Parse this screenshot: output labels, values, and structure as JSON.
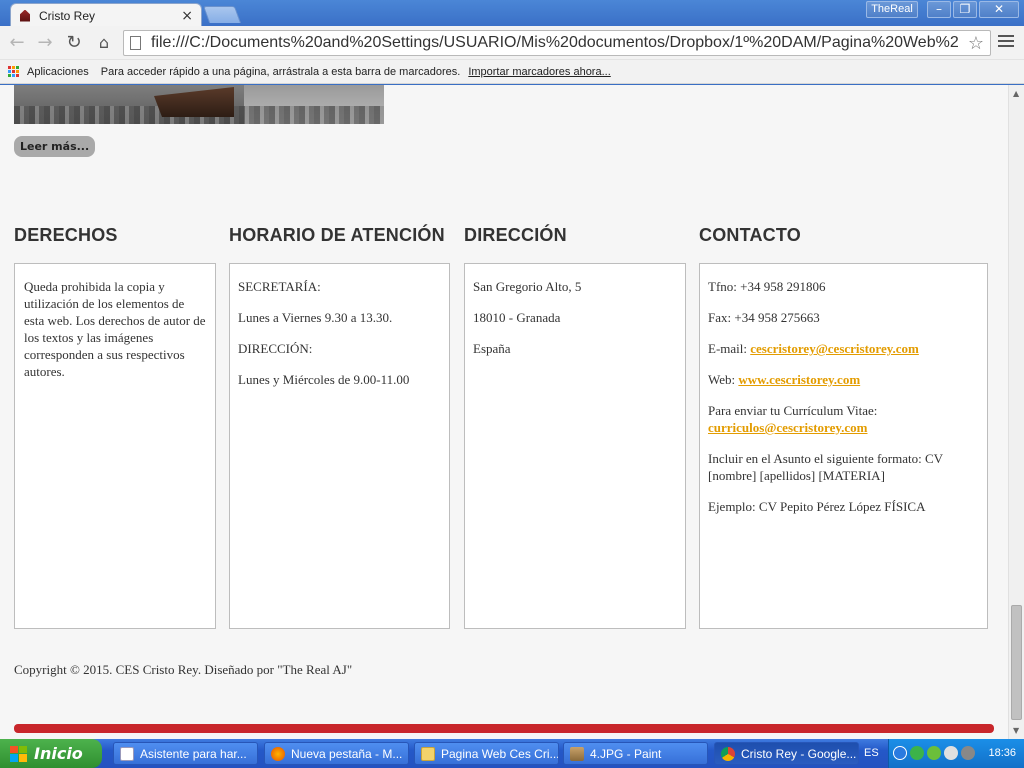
{
  "browser": {
    "tab_title": "Cristo Rey",
    "tab_close": "×",
    "user": "TheReal",
    "window_min": "–",
    "window_max": "❐",
    "window_close": "✕",
    "url": "file:///C:/Documents%20and%20Settings/USUARIO/Mis%20documentos/Dropbox/1º%20DAM/Pagina%20Web%2",
    "nav_back": "←",
    "nav_forward": "→",
    "nav_reload": "↻",
    "nav_home": "⌂",
    "star": "☆"
  },
  "bookmarks": {
    "apps": "Aplicaciones",
    "hint": "Para acceder rápido a una página, arrástrala a esta barra de marcadores.",
    "import": "Importar marcadores ahora..."
  },
  "page": {
    "read_more": "Leer más...",
    "columns": {
      "derechos": {
        "title": "DERECHOS",
        "text": "Queda prohibida la copia y utilización de los elementos de esta web. Los derechos de autor de los textos y las imágenes corresponden a sus respectivos autores."
      },
      "horario": {
        "title": "HORARIO DE ATENCIÓN",
        "secretaria_label": "SECRETARÍA:",
        "secretaria_hours": "Lunes a Viernes 9.30 a 13.30.",
        "direccion_label": "DIRECCIÓN:",
        "direccion_hours": "Lunes y Miércoles de 9.00-11.00"
      },
      "direccion": {
        "title": "DIRECCIÓN",
        "street": "San Gregorio Alto, 5",
        "city": "18010 - Granada",
        "country": "España"
      },
      "contacto": {
        "title": "CONTACTO",
        "phone": "Tfno: +34 958 291806",
        "fax": "Fax: +34 958 275663",
        "email_label": "E-mail:",
        "email": "cescristorey@cescristorey.com",
        "web_label": "Web:",
        "web": "www.cescristorey.com",
        "cv_label": "Para enviar tu Currículum Vitae:",
        "cv_email": "curriculos@cescristorey.com",
        "subject_hint": "Incluir en el Asunto el siguiente formato: CV [nombre] [apellidos] [MATERIA]",
        "example": "Ejemplo: CV Pepito Pérez López FÍSICA"
      }
    },
    "copyright": "Copyright © 2015. CES Cristo Rey. Diseñado por \"The Real AJ\""
  },
  "taskbar": {
    "start": "Inicio",
    "tasks": [
      {
        "label": "Asistente para har..."
      },
      {
        "label": "Nueva pestaña - M..."
      },
      {
        "label": "Pagina Web Ces Cri..."
      },
      {
        "label": "4.JPG - Paint"
      },
      {
        "label": "Cristo Rey - Google..."
      }
    ],
    "lang": "ES",
    "clock": "18:36"
  },
  "colors": {
    "accent_link": "#e39c00",
    "footer_bar": "#c8262b",
    "page_bg": "#f6f6f6"
  }
}
